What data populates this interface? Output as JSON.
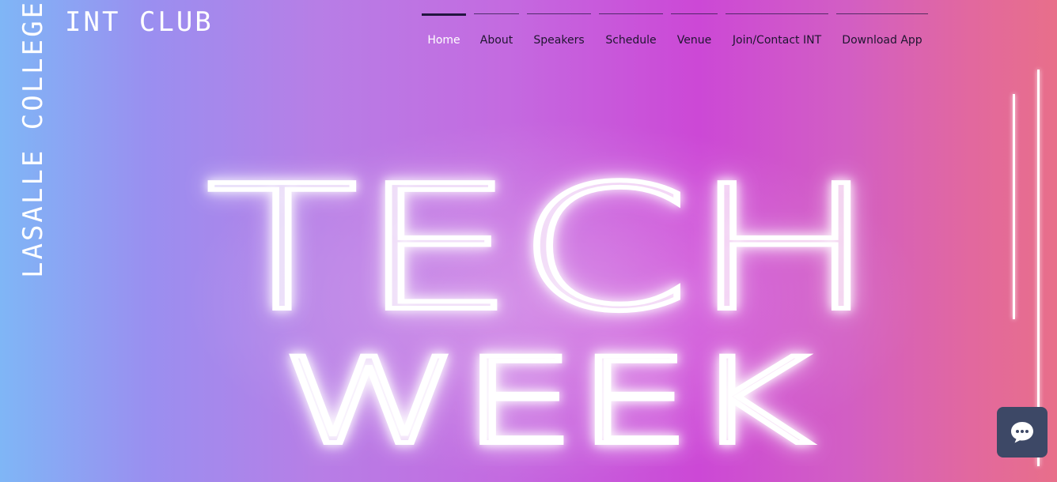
{
  "brand": {
    "college": "LASALLE COLLEGE",
    "club": "INT CLUB"
  },
  "nav": {
    "items": [
      {
        "label": "Home"
      },
      {
        "label": "About"
      },
      {
        "label": "Speakers"
      },
      {
        "label": "Schedule"
      },
      {
        "label": "Venue"
      },
      {
        "label": "Join/Contact INT"
      },
      {
        "label": "Download App"
      }
    ],
    "active_index": 0
  },
  "hero": {
    "line1": "TECH",
    "line2": "WEEK"
  },
  "chat": {
    "icon": "chat-bubble-icon"
  },
  "colors": {
    "gradient_start": "#7fb6f6",
    "gradient_mid": "#cc48d6",
    "gradient_end": "#e86f8a",
    "nav_active": "#221540",
    "chat_bg": "#3d4866",
    "neon": "#ffffff"
  }
}
